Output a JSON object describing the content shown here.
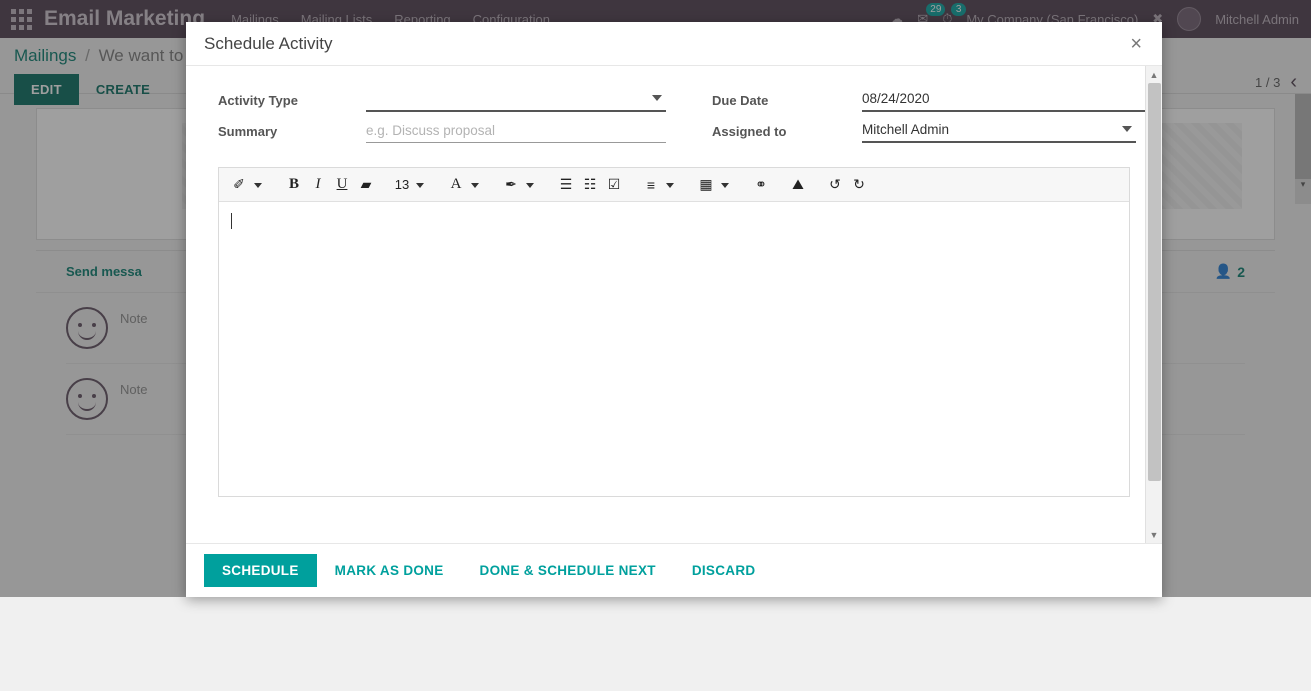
{
  "navbar": {
    "apps_icon": "apps-grid-icon",
    "brand": "Email Marketing",
    "menu": [
      "Mailings",
      "Mailing Lists",
      "Reporting",
      "Configuration"
    ],
    "messages_badge": "29",
    "activities_badge": "3",
    "company": "My Company (San Francisco)",
    "user": "Mitchell Admin"
  },
  "control_panel": {
    "breadcrumb_root": "Mailings",
    "breadcrumb_sep": "/",
    "breadcrumb_current": "We want to",
    "edit_label": "EDIT",
    "create_label": "CREATE",
    "pager": "1 / 3",
    "pager_prev": "‹"
  },
  "chatter": {
    "send_message": "Send messa",
    "followers_count": "2",
    "messages": [
      {
        "author": "Note"
      },
      {
        "author": "Note"
      }
    ]
  },
  "modal": {
    "title": "Schedule Activity",
    "close_label": "×",
    "fields": {
      "activity_type_label": "Activity Type",
      "activity_type_value": "",
      "summary_label": "Summary",
      "summary_value": "",
      "summary_placeholder": "e.g. Discuss proposal",
      "due_date_label": "Due Date",
      "due_date_value": "08/24/2020",
      "assigned_to_label": "Assigned to",
      "assigned_to_value": "Mitchell Admin"
    },
    "toolbar": {
      "style_label": "✐",
      "bold_label": "B",
      "italic_label": "I",
      "underline_label": "U",
      "eraser_label": "▰",
      "font_size_label": "13",
      "font_color_label": "A",
      "highlight_label": "✒",
      "unordered_list_label": "☰",
      "ordered_list_label": "☷",
      "checklist_label": "☑",
      "align_label": "≡",
      "table_label": "▦",
      "link_label": "⚭",
      "image_label": "⛰",
      "undo_label": "↺",
      "redo_label": "↻"
    },
    "editor_content": "",
    "footer": {
      "schedule": "SCHEDULE",
      "mark_as_done": "MARK AS DONE",
      "done_and_schedule_next": "DONE & SCHEDULE NEXT",
      "discard": "DISCARD"
    }
  },
  "colors": {
    "navbar_bg": "#4b3a4b",
    "primary_teal": "#00a09d",
    "edit_green": "#00695c",
    "link_teal": "#00796b"
  }
}
